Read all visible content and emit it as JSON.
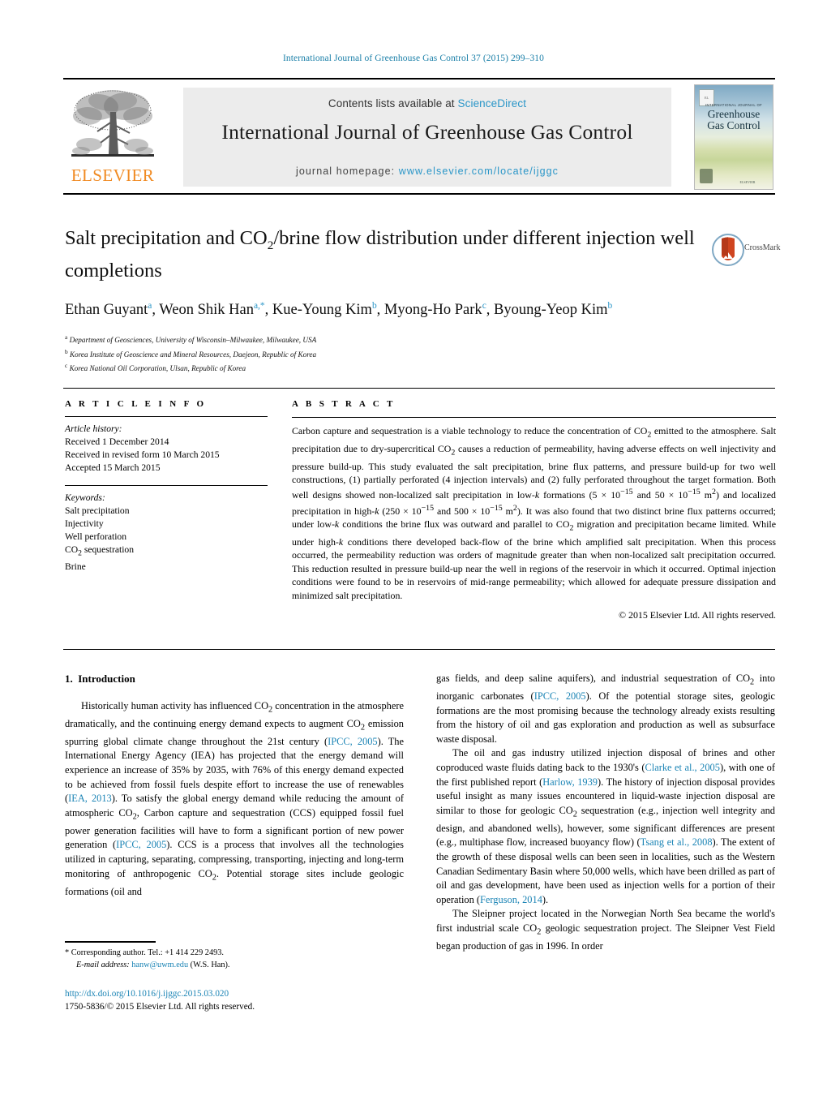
{
  "running_head": "International Journal of Greenhouse Gas Control 37 (2015) 299–310",
  "masthead": {
    "contents_prefix": "Contents lists available at ",
    "sciencedirect": "ScienceDirect",
    "journal_title": "International Journal of Greenhouse Gas Control",
    "homepage_prefix": "journal homepage: ",
    "homepage_url": "www.elsevier.com/locate/ijggc",
    "publisher_wordmark": "ELSEVIER",
    "cover": {
      "kicker": "INTERNATIONAL JOURNAL OF",
      "name_line1": "Greenhouse",
      "name_line2": "Gas Control",
      "footer": "ELSEVIER"
    }
  },
  "crossmark": {
    "label": "CrossMark"
  },
  "article": {
    "title_line1": "Salt precipitation and CO",
    "title_sub": "2",
    "title_line1b": "/brine flow distribution under different",
    "title_line2": "injection well completions",
    "authors_html": "Ethan Guyant, Weon Shik Han, Kue-Young Kim, Myong-Ho Park, Byoung-Yeop Kim",
    "affiliations": [
      {
        "mark": "a",
        "text": "Department of Geosciences, University of Wisconsin–Milwaukee, Milwaukee, USA"
      },
      {
        "mark": "b",
        "text": "Korea Institute of Geoscience and Mineral Resources, Daejeon, Republic of Korea"
      },
      {
        "mark": "c",
        "text": "Korea National Oil Corporation, Ulsan, Republic of Korea"
      }
    ]
  },
  "info": {
    "heading": "A R T I C L E    I N F O",
    "history_label": "Article history:",
    "history": [
      "Received 1 December 2014",
      "Received in revised form 10 March 2015",
      "Accepted 15 March 2015"
    ],
    "keywords_label": "Keywords:",
    "keywords": [
      "Salt precipitation",
      "Injectivity",
      "Well perforation",
      "CO2 sequestration",
      "Brine"
    ]
  },
  "abstract": {
    "heading": "A B S T R A C T",
    "body": "Carbon capture and sequestration is a viable technology to reduce the concentration of CO2 emitted to the atmosphere. Salt precipitation due to dry-supercritical CO2 causes a reduction of permeability, having adverse effects on well injectivity and pressure build-up. This study evaluated the salt precipitation, brine flux patterns, and pressure build-up for two well constructions, (1) partially perforated (4 injection intervals) and (2) fully perforated throughout the target formation. Both well designs showed non-localized salt precipitation in low-k formations (5 × 10−15 and 50 × 10−15 m2) and localized precipitation in high-k (250 × 10−15 and 500 × 10−15 m2). It was also found that two distinct brine flux patterns occurred; under low-k conditions the brine flux was outward and parallel to CO2 migration and precipitation became limited. While under high-k conditions there developed back-flow of the brine which amplified salt precipitation. When this process occurred, the permeability reduction was orders of magnitude greater than when non-localized salt precipitation occurred. This reduction resulted in pressure build-up near the well in regions of the reservoir in which it occurred. Optimal injection conditions were found to be in reservoirs of mid-range permeability; which allowed for adequate pressure dissipation and minimized salt precipitation.",
    "copyright": "© 2015 Elsevier Ltd. All rights reserved."
  },
  "body": {
    "section_number": "1.",
    "section_title": "Introduction",
    "left_paragraph": "Historically human activity has influenced CO2 concentration in the atmosphere dramatically, and the continuing energy demand expects to augment CO2 emission spurring global climate change throughout the 21st century (IPCC, 2005). The International Energy Agency (IEA) has projected that the energy demand will experience an increase of 35% by 2035, with 76% of this energy demand expected to be achieved from fossil fuels despite effort to increase the use of renewables (IEA, 2013). To satisfy the global energy demand while reducing the amount of atmospheric CO2, Carbon capture and sequestration (CCS) equipped fossil fuel power generation facilities will have to form a significant portion of new power generation (IPCC, 2005). CCS is a process that involves all the technologies utilized in capturing, separating, compressing, transporting, injecting and long-term monitoring of anthropogenic CO2. Potential storage sites include geologic formations (oil and",
    "right_paragraph_1": "gas fields, and deep saline aquifers), and industrial sequestration of CO2 into inorganic carbonates (IPCC, 2005). Of the potential storage sites, geologic formations are the most promising because the technology already exists resulting from the history of oil and gas exploration and production as well as subsurface waste disposal.",
    "right_paragraph_2": "The oil and gas industry utilized injection disposal of brines and other coproduced waste fluids dating back to the 1930's (Clarke et al., 2005), with one of the first published report (Harlow, 1939). The history of injection disposal provides useful insight as many issues encountered in liquid-waste injection disposal are similar to those for geologic CO2 sequestration (e.g., injection well integrity and design, and abandoned wells), however, some significant differences are present (e.g., multiphase flow, increased buoyancy flow) (Tsang et al., 2008). The extent of the growth of these disposal wells can been seen in localities, such as the Western Canadian Sedimentary Basin where 50,000 wells, which have been drilled as part of oil and gas development, have been used as injection wells for a portion of their operation (Ferguson, 2014).",
    "right_paragraph_3": "The Sleipner project located in the Norwegian North Sea became the world's first industrial scale CO2 geologic sequestration project. The Sleipner Vest Field began production of gas in 1996. In order",
    "citations": [
      "IPCC, 2005",
      "IEA, 2013",
      "Clarke et al., 2005",
      "Harlow, 1939",
      "Tsang et al., 2008",
      "Ferguson, 2014"
    ]
  },
  "footnote": {
    "star": "*",
    "corresponding": "Corresponding author. Tel.: +1 414 229 2493.",
    "email_label": "E-mail address:",
    "email": "hanw@uwm.edu",
    "email_suffix": "(W.S. Han)."
  },
  "doi_block": {
    "doi_url": "http://dx.doi.org/10.1016/j.ijggc.2015.03.020",
    "issn_line": "1750-5836/© 2015 Elsevier Ltd. All rights reserved."
  },
  "colors": {
    "link_blue": "#1b84b5",
    "sd_blue": "#2a96c8",
    "elsevier_orange": "#f08a22",
    "panel_gray": "#ececec"
  }
}
